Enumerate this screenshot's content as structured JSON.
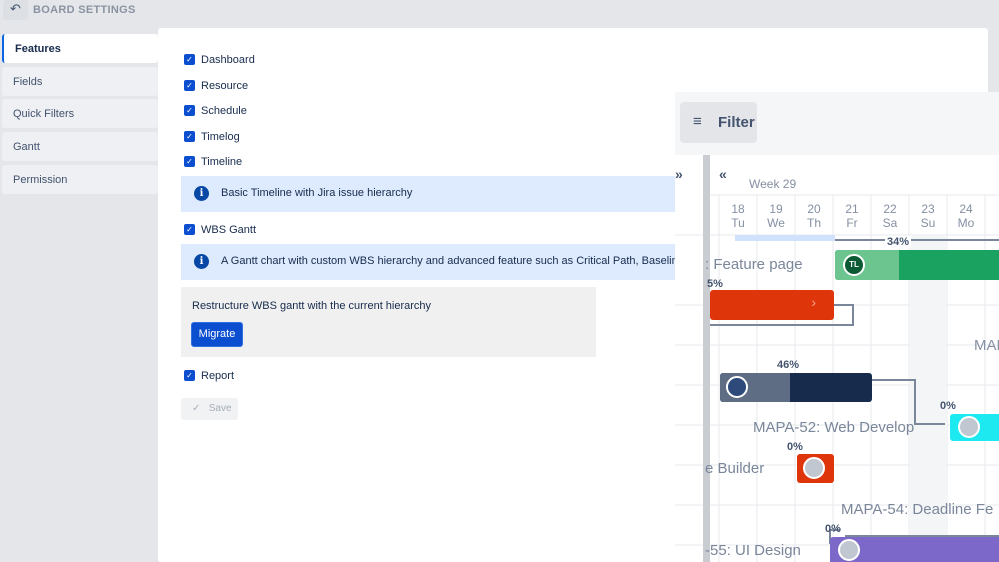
{
  "header": {
    "back_icon": "undo-arrow-icon",
    "title": "BOARD SETTINGS"
  },
  "sidebar": {
    "items": [
      {
        "label": "Features",
        "active": true
      },
      {
        "label": "Fields"
      },
      {
        "label": "Quick Filters"
      },
      {
        "label": "Gantt"
      },
      {
        "label": "Permission"
      }
    ]
  },
  "features": {
    "items": [
      {
        "label": "Dashboard",
        "checked": true
      },
      {
        "label": "Resource",
        "checked": true
      },
      {
        "label": "Schedule",
        "checked": true
      },
      {
        "label": "Timelog",
        "checked": true
      },
      {
        "label": "Timeline",
        "checked": true
      },
      {
        "label": "WBS Gantt",
        "checked": true
      },
      {
        "label": "Report",
        "checked": true
      }
    ],
    "timeline_info": "Basic Timeline with Jira issue hierarchy",
    "wbs_info": "A Gantt chart with custom WBS hierarchy and advanced feature such as Critical Path, Baseline, Milestone",
    "migrate_text": "Restructure WBS gantt with the current hierarchy",
    "migrate_label": "Migrate",
    "save_label": "Save"
  },
  "gantt": {
    "filter_label": "Filter",
    "week": "Week 29",
    "days": [
      {
        "num": "18",
        "day": "Tu"
      },
      {
        "num": "19",
        "day": "We"
      },
      {
        "num": "20",
        "day": "Th"
      },
      {
        "num": "21",
        "day": "Fr"
      },
      {
        "num": "22",
        "day": "Sa"
      },
      {
        "num": "23",
        "day": "Su"
      },
      {
        "num": "24",
        "day": "Mo"
      }
    ],
    "tasks": {
      "t1": ": Feature page",
      "t1_pct": "34%",
      "t1_avatar": "TL",
      "t2_pct": "5%",
      "t3_label": "MAPA",
      "t4_pct": "46%",
      "t5": "MAPA-52: Web Develop",
      "t5_pct": "0%",
      "t6": "e Builder",
      "t6_pct": "0%",
      "t7": "MAPA-54: Deadline Fe",
      "t8": "-55: UI Design",
      "t8_pct": "0%"
    },
    "colors": {
      "green": "#1aa260",
      "red": "#de350b",
      "navy": "#172b4d",
      "cyan": "#1de9f0",
      "purple": "#7b68c8"
    }
  }
}
